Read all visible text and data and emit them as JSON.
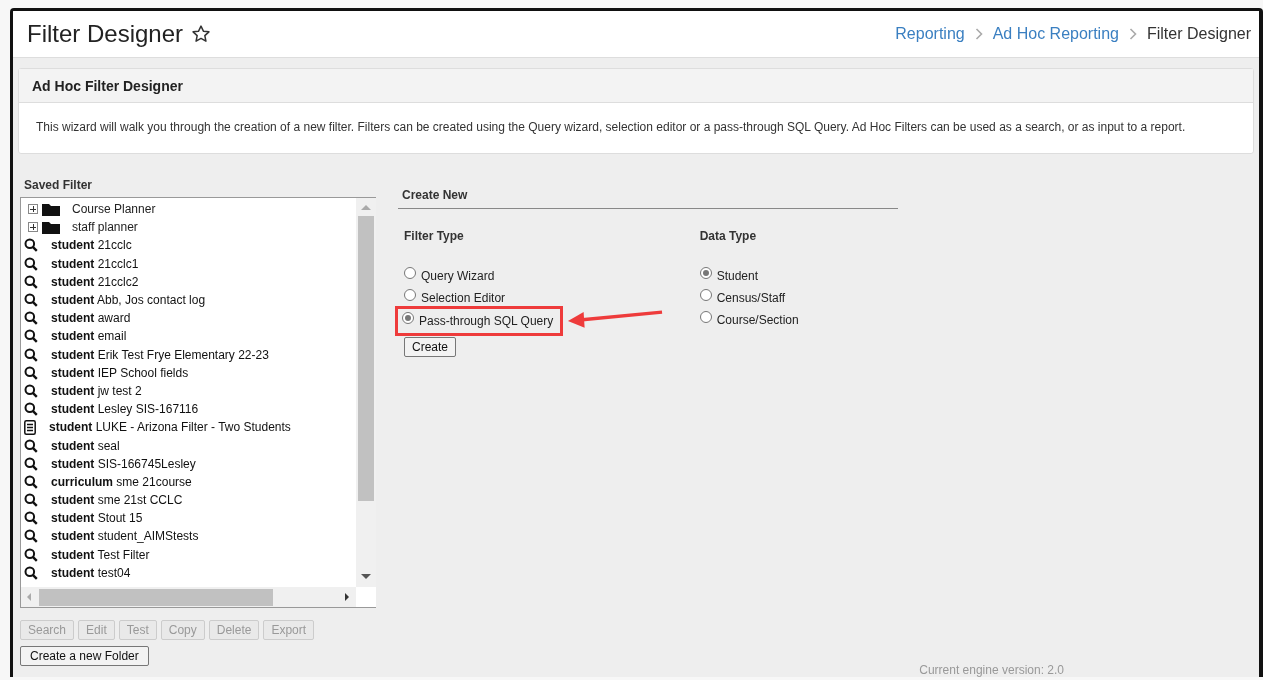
{
  "header": {
    "title": "Filter Designer",
    "breadcrumbs": [
      {
        "label": "Reporting",
        "link": true
      },
      {
        "label": "Ad Hoc Reporting",
        "link": true
      },
      {
        "label": "Filter Designer",
        "link": false
      }
    ]
  },
  "panel": {
    "title": "Ad Hoc Filter Designer",
    "description": "This wizard will walk you through the creation of a new filter. Filters can be created using the Query wizard, selection editor or a pass-through SQL Query. Ad Hoc Filters can be used as a search, or as input to a report."
  },
  "saved_filter": {
    "label": "Saved Filter",
    "items": [
      {
        "kind": "folder",
        "text": "Course Planner"
      },
      {
        "kind": "folder",
        "text": "staff planner"
      },
      {
        "kind": "query",
        "text": "**student** 21cclc"
      },
      {
        "kind": "query",
        "text": "**student** 21cclc1"
      },
      {
        "kind": "query",
        "text": "**student** 21cclc2"
      },
      {
        "kind": "query",
        "text": "**student** Abb, Jos contact log"
      },
      {
        "kind": "query",
        "text": "**student** award"
      },
      {
        "kind": "query",
        "text": "**student** email"
      },
      {
        "kind": "query",
        "text": "**student** Erik Test Frye Elementary 22-23"
      },
      {
        "kind": "query",
        "text": "**student** IEP School fields"
      },
      {
        "kind": "query",
        "text": "**student** jw test 2"
      },
      {
        "kind": "query",
        "text": "**student** Lesley SIS-167116"
      },
      {
        "kind": "report",
        "text": "**student** LUKE - Arizona Filter - Two Students"
      },
      {
        "kind": "query",
        "text": "**student** seal"
      },
      {
        "kind": "query",
        "text": "**student** SIS-166745Lesley"
      },
      {
        "kind": "query",
        "text": "**curriculum** sme 21course"
      },
      {
        "kind": "query",
        "text": "**student** sme 21st CCLC"
      },
      {
        "kind": "query",
        "text": "**student** Stout 15"
      },
      {
        "kind": "query",
        "text": "**student** student_AIMStests"
      },
      {
        "kind": "query",
        "text": "**student** Test Filter"
      },
      {
        "kind": "query",
        "text": "**student** test04"
      }
    ],
    "buttons": [
      {
        "label": "Search",
        "disabled": true
      },
      {
        "label": "Edit",
        "disabled": true
      },
      {
        "label": "Test",
        "disabled": true
      },
      {
        "label": "Copy",
        "disabled": true
      },
      {
        "label": "Delete",
        "disabled": true
      },
      {
        "label": "Export",
        "disabled": true
      }
    ],
    "folder_button": {
      "label": "Create a new Folder",
      "disabled": false
    }
  },
  "create_new": {
    "title": "Create New",
    "filter_type": {
      "label": "Filter Type",
      "options": [
        {
          "label": "Query Wizard",
          "selected": false,
          "highlighted": false
        },
        {
          "label": "Selection Editor",
          "selected": false,
          "highlighted": false
        },
        {
          "label": "Pass-through SQL Query",
          "selected": true,
          "highlighted": true
        }
      ]
    },
    "data_type": {
      "label": "Data Type",
      "options": [
        {
          "label": "Student",
          "selected": true
        },
        {
          "label": "Census/Staff",
          "selected": false
        },
        {
          "label": "Course/Section",
          "selected": false
        }
      ]
    },
    "create_button": "Create"
  },
  "footer": "Current engine version: 2.0"
}
